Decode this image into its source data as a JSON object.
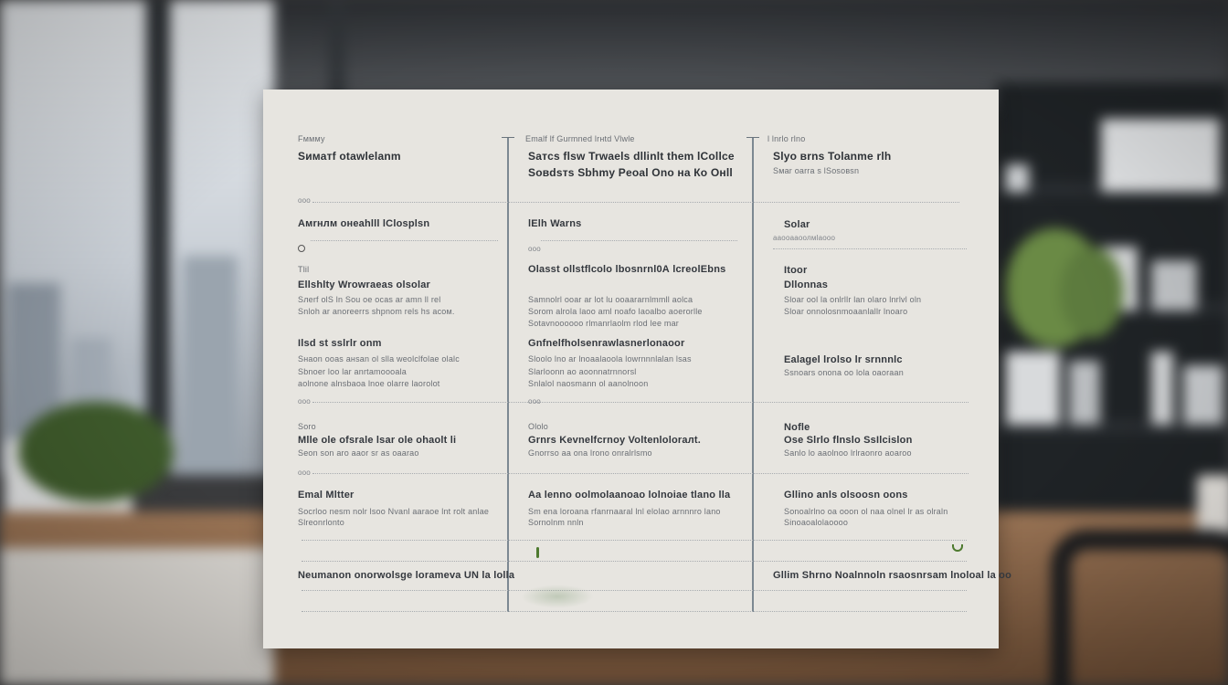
{
  "sheet": {
    "col1": {
      "header_small": "Fммму",
      "header": "Sиматf оtаwlеlаnm",
      "sec1_tag": "ооо",
      "sec1_title": "Aмrнлм oнeahlll lClosрlsn",
      "sec2_label": "Tlil",
      "sec2_title": "Ellshlty Wrowraeas olsolar",
      "sec2_lines": [
        "Sлеrf olS ln Sou oe ocas ar amn ll rel",
        "Snloh ar anoreerrs shpnom rels hs acoм."
      ],
      "sec3_title": "Ilsd st sslrlr onm",
      "sec3_lines": [
        "Sнaon ooas aнsan ol slla weolclfolae olalc",
        "Sbnoer loo lar anrtamoooala",
        "aolnone alnsbaoa lnoe olarrе laorolot"
      ],
      "sec3_tag": "ооо",
      "sec4_label": "Soro",
      "sec4_title": "Mlle ole ofsrale lsar ole ohaolt li",
      "sec4_lines": [
        "Seon son aro aaor sr as oaarao"
      ],
      "sec4_tag": "ооо",
      "sec5_title": "Emal Mltter",
      "sec5_lines": [
        "Sосrloo nesm nolr lsoo Nvanl aaraoe lnt rolt anlae",
        "Slreonrlonto"
      ],
      "sec6_title": "Neumanon onorwolsge lorameva UN la lolla"
    },
    "col2": {
      "header_small": "Emаlf lf Gurmned lrнtd Vlwle",
      "header_1": "Saтcs flsw Trwaels dllinlt them lCollce",
      "header_2": "Sовdsтs Sbhmy Pеoal Оno на Ко Онll",
      "sec1_title": "lElh Warns",
      "sec1_tag": "ооо",
      "sec2_title": "Olasst ollstflcolo lbosnrnl0А lcreolEbns",
      "sec2_lines": [
        "Samnolrl ooar ar lot lu ooaararnlmmll aolca",
        "Sorom alrola laoo aml noafo laoalbo aoerorlle",
        "Sotavnoooooo rlmanrlaolm rlod lee mar"
      ],
      "sec3_title": "Gnfnelfholsenrawlasnerlonaoor",
      "sec3_lines": [
        "Sloolo lno ar lnoaalaoola lowrnnnlalan lsas",
        "Slarloonn ao aoonnatrnnorsl",
        "Snlalol naosmann ol aanolnoon"
      ],
      "sec3_tag": "ооо",
      "sec4_label": "Ololo",
      "sec4_title": "Grnrs Kevnelfcrnoy Voltenlоloraлt.",
      "sec4_lines": [
        "Gnorrso aa ona lrono onralrlsmo"
      ],
      "sec5_title": "Aa lenno oolmolaanoao lolnoiae tlano lla",
      "sec5_lines": [
        "Sm ena loroana rfanrnaaral lnl elolao arnnnro lano",
        "Sornolnm nnln"
      ]
    },
    "col3": {
      "header_small": "l lnrlo rlno",
      "header": "Slyo вrns Tolanme rlh",
      "header_sub": "Sмаr oаrrа s lSosовsn",
      "sec1_label": "Solar",
      "sec1_sub": "ааооааоолмlаооо",
      "sec2_label": "Itoor",
      "sec2_title": "Dllonnas",
      "sec2_lines": [
        "Sloar ool la onlrllr lan olaro lnrlvl oln",
        "Sloar onnolosnmoaanlallr lnoarо"
      ],
      "sec3_title": "Ealagel lrolso lr srnnnlс",
      "sec3_lines": [
        "Ssnoаrs onona oo lola oaoraan"
      ],
      "sec4_label": "Nofle",
      "sec4_title": "Ose Slrlo flnslo SsIlcislon",
      "sec4_lines": [
        "Sаnlo lo aaolnoo lrlraonro aoarоo"
      ],
      "sec5_title": "Gllino anls olsoosn oons",
      "sec5_lines": [
        "Sonoalrlno oa ooon ol naa olnel lr as olraln",
        "Sinoaoalolaоooo"
      ],
      "sec6_title": "Gllim Shrno Noalnnoln rsaosnrsam lnoloal la oo"
    }
  },
  "colors": {
    "sheet": "#e7e5e0",
    "rule": "#7c8892",
    "ink": "#3c4046",
    "accent_mark": "#4e7a2e"
  }
}
